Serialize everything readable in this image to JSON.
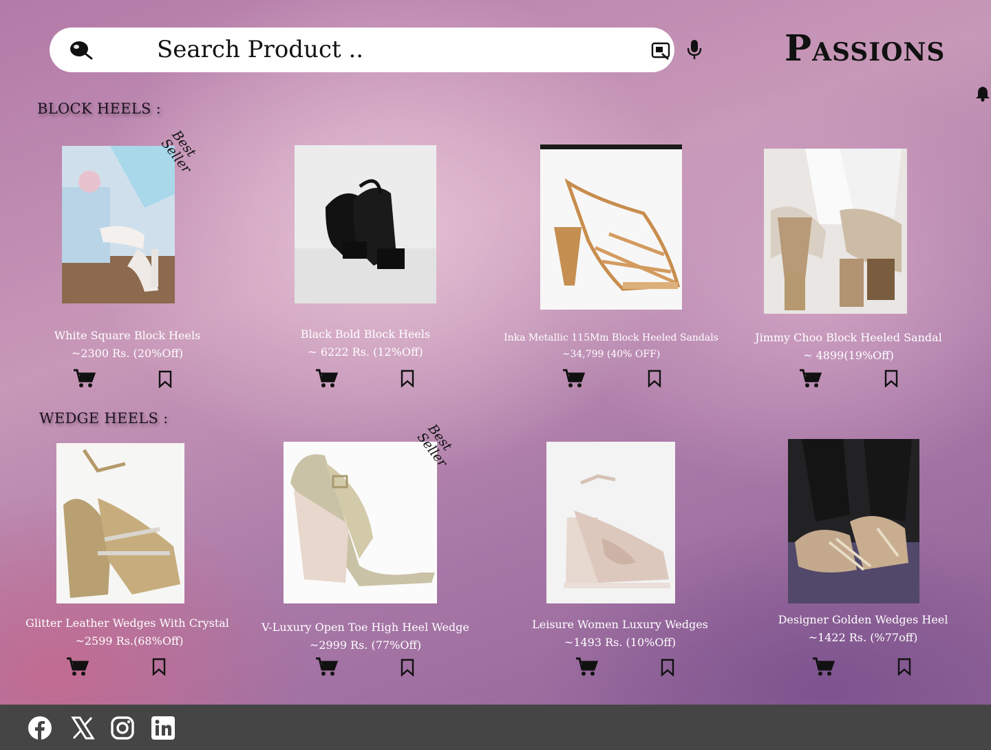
{
  "search": {
    "placeholder": "Search Product ..",
    "value": ""
  },
  "brand": {
    "name": "Passions"
  },
  "icons": {
    "search": "search-icon",
    "lens": "image-search-icon",
    "mic": "microphone-icon",
    "bell": "bell-icon",
    "cart": "cart-icon",
    "save": "bookmark-icon"
  },
  "sections": {
    "block": {
      "title": "BLOCK HEELS :"
    },
    "wedge": {
      "title": "WEDGE HEELS :"
    }
  },
  "badge": {
    "line1": "Best",
    "line2": "Seller"
  },
  "products": {
    "block": [
      {
        "name": "White Square Block Heels",
        "price": "~2300 Rs.  (20%Off)",
        "badge": true
      },
      {
        "name": "Black Bold Block Heels",
        "price": "~ 6222 Rs. (12%Off)",
        "badge": false
      },
      {
        "name": "Inka Metallic 115Mm Block Heeled Sandals",
        "price": "~34,799 (40% OFF)",
        "badge": false
      },
      {
        "name": "Jimmy Choo Block Heeled Sandal",
        "price": "~ 4899(19%Off)",
        "badge": false
      }
    ],
    "wedge": [
      {
        "name": "Glitter Leather Wedges With Crystal",
        "price": "~2599 Rs.(68%Off)",
        "badge": false
      },
      {
        "name": "V-Luxury Open Toe High Heel Wedge",
        "price": "~2999 Rs. (77%Off)",
        "badge": true
      },
      {
        "name": "Leisure Women Luxury Wedges",
        "price": "~1493 Rs. (10%Off)",
        "badge": false
      },
      {
        "name": "Designer Golden Wedges Heel",
        "price": "~1422 Rs. (%77off)",
        "badge": false
      }
    ]
  },
  "footer": {
    "social": [
      "facebook-icon",
      "x-icon",
      "instagram-icon",
      "linkedin-icon"
    ]
  },
  "colors": {
    "text_light": "#ffffff",
    "text_dark": "#111111",
    "footer_bg": "#454545"
  }
}
